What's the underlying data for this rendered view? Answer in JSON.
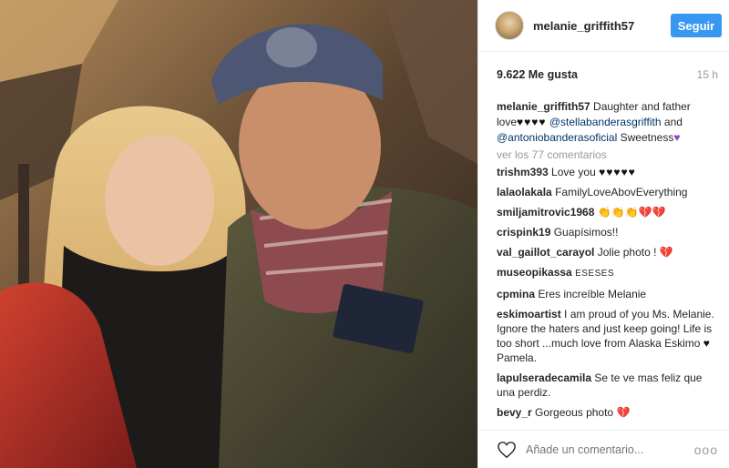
{
  "header": {
    "username": "melanie_griffith57",
    "follow_label": "Seguir"
  },
  "meta": {
    "likes": "9.622 Me gusta",
    "time": "15 h"
  },
  "caption": {
    "username": "melanie_griffith57",
    "text_1": "Daughter and father love",
    "hearts": "♥♥♥♥",
    "mention_1": "@stellabanderasgriffith",
    "and": "and",
    "mention_2": "@antoniobanderasoficial",
    "text_2": "Sweetness",
    "purple_heart": "♥"
  },
  "view_more": "ver los 77 comentarios",
  "comments": [
    {
      "user": "trishm393",
      "text": "Love you ",
      "extra": "♥♥♥♥♥"
    },
    {
      "user": "lalaolakala",
      "text": "FamilyLoveAbovEverything",
      "extra": ""
    },
    {
      "user": "smiljamitrovic1968",
      "text": "",
      "extra": "👏👏👏💔💔"
    },
    {
      "user": "crispink19",
      "text": "Guapísimos!!",
      "extra": ""
    },
    {
      "user": "val_gaillot_carayol",
      "text": "Jolie photo ! ",
      "extra": "💔"
    },
    {
      "user": "museopikassa",
      "text": "ESESES",
      "extra": ""
    },
    {
      "user": "cpmina",
      "text": "Eres increíble Melanie",
      "extra": ""
    },
    {
      "user": "eskimoartist",
      "text": "I am proud of you Ms. Melanie. Ignore the haters and just keep going! Life is too short ...much love from Alaska Eskimo ",
      "extra": "♥",
      "extra_after": " Pamela."
    },
    {
      "user": "lapulseradecamila",
      "text": "Se te ve mas feliz que una perdiz.",
      "extra": ""
    },
    {
      "user": "bevy_r",
      "text": "Gorgeous photo ",
      "extra": "💔"
    }
  ],
  "add_comment": {
    "placeholder": "Añade un comentario...",
    "more": "ooo"
  },
  "colors": {
    "follow_button": "#3897f0",
    "mention": "#003569",
    "muted": "#999999"
  },
  "icons": [
    "heart-outline-icon",
    "more-options-icon"
  ]
}
